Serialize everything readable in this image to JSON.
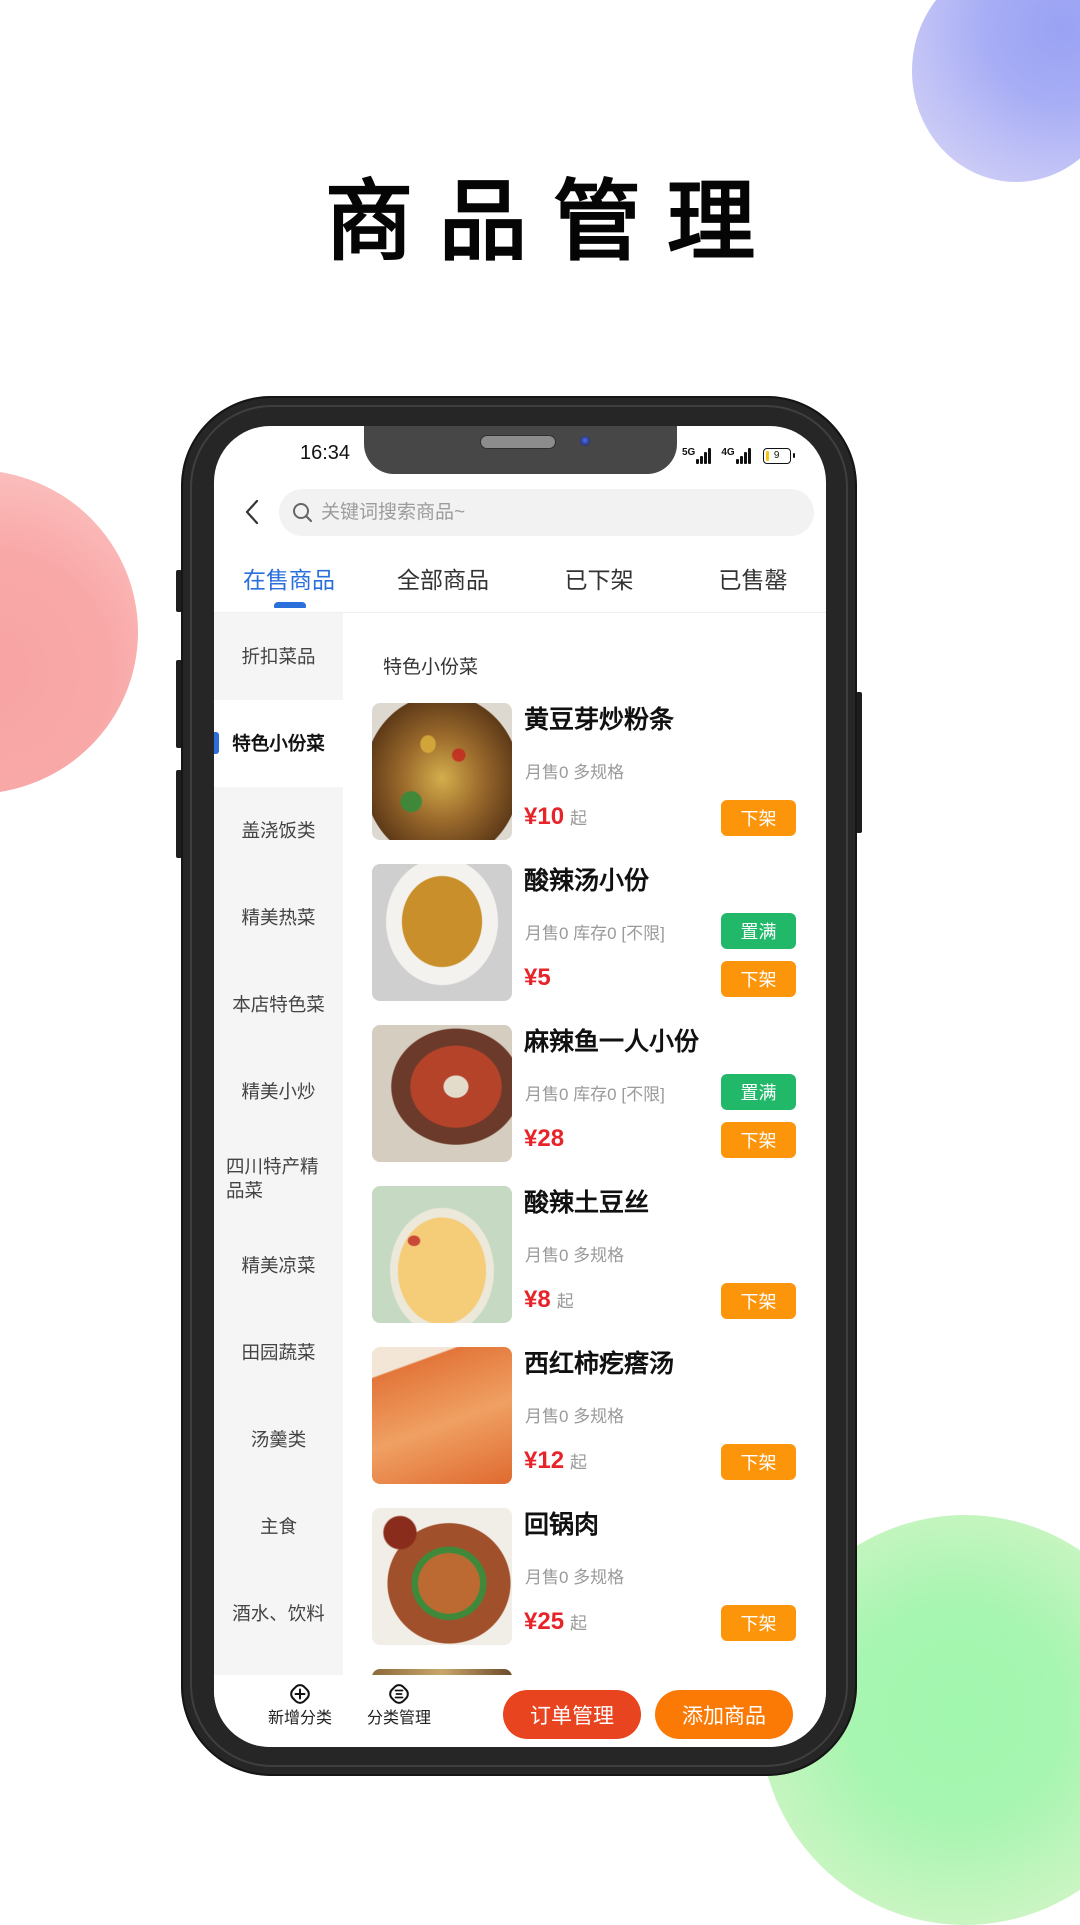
{
  "page_title": "商品管理",
  "status_bar": {
    "time": "16:34",
    "network_1": "5G",
    "network_2": "4G",
    "battery": "9"
  },
  "search": {
    "placeholder": "关键词搜索商品~",
    "value": ""
  },
  "tabs": [
    {
      "label": "在售商品",
      "active": true
    },
    {
      "label": "全部商品",
      "active": false
    },
    {
      "label": "已下架",
      "active": false
    },
    {
      "label": "已售罄",
      "active": false
    }
  ],
  "sidebar": {
    "items": [
      {
        "label": "折扣菜品"
      },
      {
        "label": "特色小份菜",
        "active": true
      },
      {
        "label": "盖浇饭类"
      },
      {
        "label": "精美热菜"
      },
      {
        "label": "本店特色菜"
      },
      {
        "label": "精美小炒"
      },
      {
        "label": "四川特产精品菜"
      },
      {
        "label": "精美凉菜"
      },
      {
        "label": "田园蔬菜"
      },
      {
        "label": "汤羹类"
      },
      {
        "label": "主食"
      },
      {
        "label": "酒水、饮料"
      }
    ]
  },
  "section_title": "特色小份菜",
  "products": [
    {
      "name": "黄豆芽炒粉条",
      "stats": "月售0 多规格",
      "price": "¥10",
      "price_suffix": "起",
      "off_shelf_label": "下架"
    },
    {
      "name": "酸辣汤小份",
      "stats": "月售0 库存0 [不限]",
      "price": "¥5",
      "price_suffix": "",
      "fill_stock_label": "置满",
      "off_shelf_label": "下架"
    },
    {
      "name": "麻辣鱼一人小份",
      "stats": "月售0 库存0 [不限]",
      "price": "¥28",
      "price_suffix": "",
      "fill_stock_label": "置满",
      "off_shelf_label": "下架"
    },
    {
      "name": "酸辣土豆丝",
      "stats": "月售0 多规格",
      "price": "¥8",
      "price_suffix": "起",
      "off_shelf_label": "下架"
    },
    {
      "name": "西红柿疙瘩汤",
      "stats": "月售0 多规格",
      "price": "¥12",
      "price_suffix": "起",
      "off_shelf_label": "下架"
    },
    {
      "name": "回锅肉",
      "stats": "月售0 多规格",
      "price": "¥25",
      "price_suffix": "起",
      "off_shelf_label": "下架"
    }
  ],
  "bottom_bar": {
    "add_category": "新增分类",
    "manage_category": "分类管理",
    "orders_button": "订单管理",
    "add_product_button": "添加商品"
  },
  "colors": {
    "accent_blue": "#2a6fdb",
    "price_red": "#e8242b",
    "off_shelf_orange": "#fd950a",
    "fill_stock_green": "#22b86a",
    "orders_button_red": "#e8441f",
    "add_product_orange": "#fb7a06"
  }
}
